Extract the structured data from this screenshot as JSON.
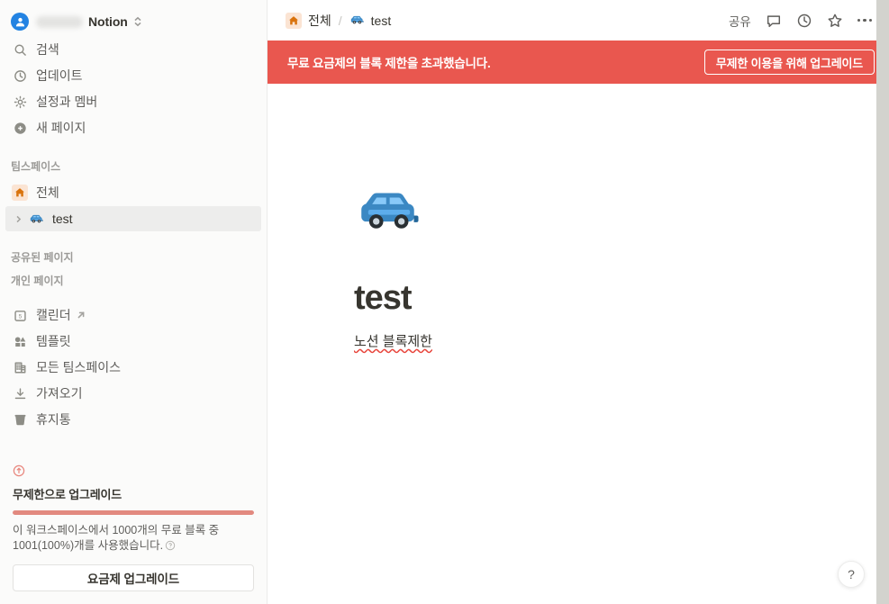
{
  "sidebar": {
    "workspace": {
      "name": "Notion",
      "avatar_icon": "user-avatar-icon",
      "chevron_icon": "chevron-updown-icon"
    },
    "quick_items": [
      {
        "label": "검색",
        "icon": "search-icon"
      },
      {
        "label": "업데이트",
        "icon": "clock-icon"
      },
      {
        "label": "설정과 멤버",
        "icon": "gear-icon"
      },
      {
        "label": "새 페이지",
        "icon": "plus-circle-icon"
      }
    ],
    "teamspace_section_label": "팀스페이스",
    "teamspace_items": [
      {
        "label": "전체",
        "icon": "house-emoji",
        "selected": false
      },
      {
        "label": "test",
        "icon": "car-emoji",
        "selected": true
      }
    ],
    "shared_section_label": "공유된 페이지",
    "private_section_label": "개인 페이지",
    "utility_items": [
      {
        "label": "캘린더",
        "icon": "calendar-icon",
        "external": true
      },
      {
        "label": "템플릿",
        "icon": "templates-icon",
        "external": false
      },
      {
        "label": "모든 팀스페이스",
        "icon": "building-icon",
        "external": false
      },
      {
        "label": "가져오기",
        "icon": "import-icon",
        "external": false
      },
      {
        "label": "휴지통",
        "icon": "trash-icon",
        "external": false
      }
    ],
    "upgrade": {
      "arrow_icon": "arrow-up-circle-icon",
      "title": "무제한으로 업그레이드",
      "progress_percent": 100,
      "description": "이 워크스페이스에서 1000개의 무료 블록 중 1001(100%)개를 사용했습니다.",
      "help_icon": "question-circle-icon",
      "button_label": "요금제 업그레이드",
      "bar_color": "#e2897f"
    }
  },
  "topbar": {
    "breadcrumb": [
      {
        "label": "전체",
        "icon": "house-emoji"
      },
      {
        "label": "test",
        "icon": "car-emoji"
      }
    ],
    "separator": "/",
    "share_label": "공유",
    "actions": [
      {
        "name": "comments-icon"
      },
      {
        "name": "updates-clock-icon"
      },
      {
        "name": "star-icon"
      },
      {
        "name": "more-dots-icon"
      }
    ]
  },
  "banner": {
    "message": "무료 요금제의 블록 제한을 초과했습니다.",
    "button_label": "무제한 이용을 위해 업그레이드",
    "background_color": "#e9574f"
  },
  "page": {
    "emoji": "car-emoji",
    "title": "test",
    "paragraph": "노션 블록제한"
  },
  "help": {
    "label": "?"
  }
}
